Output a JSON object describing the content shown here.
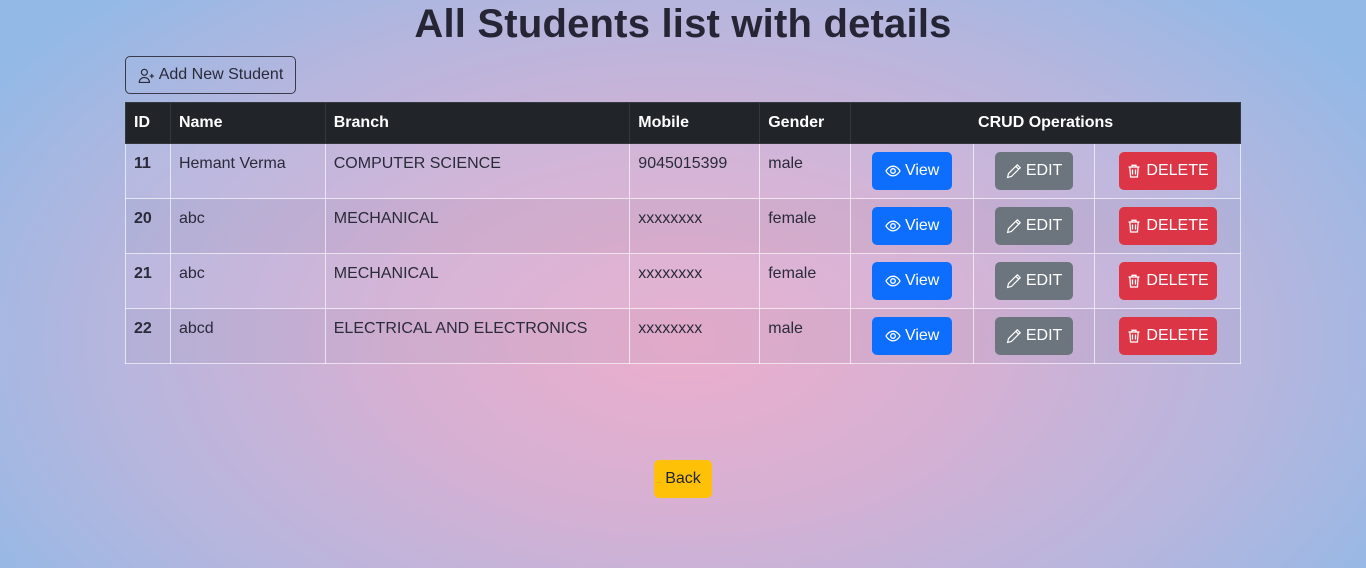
{
  "page": {
    "title": "All Students list with details",
    "add_button_label": "Add New Student",
    "back_button_label": "Back"
  },
  "table": {
    "headers": {
      "id": "ID",
      "name": "Name",
      "branch": "Branch",
      "mobile": "Mobile",
      "gender": "Gender",
      "crud": "CRUD Operations"
    },
    "rows": [
      {
        "id": "11",
        "name": "Hemant Verma",
        "branch": "COMPUTER SCIENCE",
        "mobile": "9045015399",
        "gender": "male"
      },
      {
        "id": "20",
        "name": "abc",
        "branch": "MECHANICAL",
        "mobile": "xxxxxxxx",
        "gender": "female"
      },
      {
        "id": "21",
        "name": "abc",
        "branch": "MECHANICAL",
        "mobile": "xxxxxxxx",
        "gender": "female"
      },
      {
        "id": "22",
        "name": "abcd",
        "branch": "ELECTRICAL AND ELECTRONICS",
        "mobile": "xxxxxxxx",
        "gender": "male"
      }
    ],
    "actions": {
      "view_label": "View",
      "edit_label": "EDIT",
      "delete_label": "DELETE"
    }
  },
  "icons": {
    "add": "person-plus-icon",
    "view": "eye-icon",
    "edit": "pencil-icon",
    "delete": "trash-icon"
  },
  "colors": {
    "view": "#0d6efd",
    "edit": "#6c757d",
    "delete": "#dc3545",
    "back": "#ffc107",
    "header_bg": "#212529"
  }
}
